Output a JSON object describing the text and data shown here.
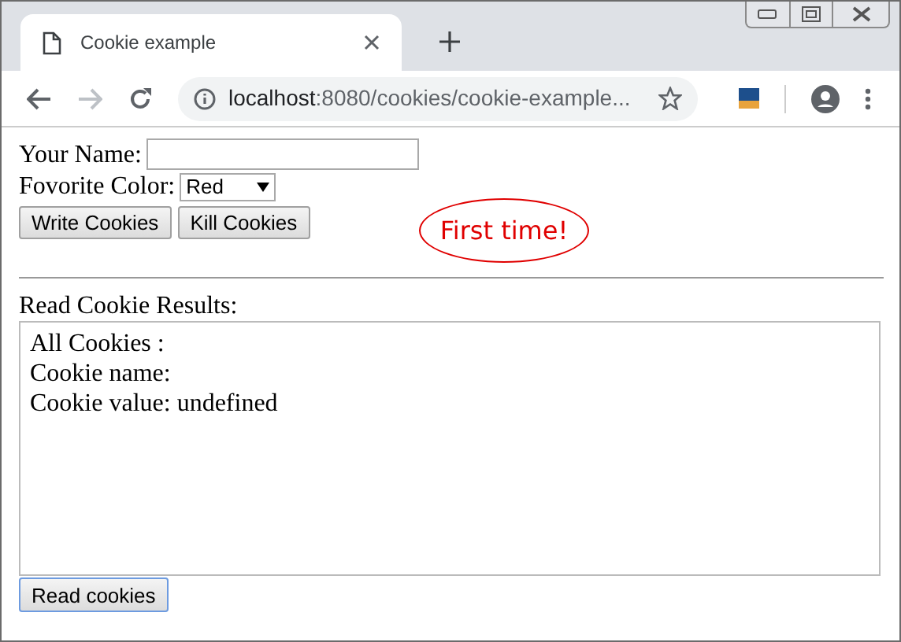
{
  "tab": {
    "title": "Cookie example",
    "selected": true
  },
  "address_bar": {
    "host": "localhost",
    "path": ":8080/cookies/cookie-example..."
  },
  "form": {
    "name_label": "Your Name:",
    "color_label": "Fovorite Color:",
    "color_value": "Red",
    "buttons": [
      "Write Cookies",
      "Kill Cookies"
    ]
  },
  "bubble": "First time!",
  "results": {
    "label": "Read Cookie Results:",
    "lines": [
      "All Cookies :",
      "Cookie name:",
      "Cookie value: undefined"
    ],
    "button": "Read cookies"
  }
}
